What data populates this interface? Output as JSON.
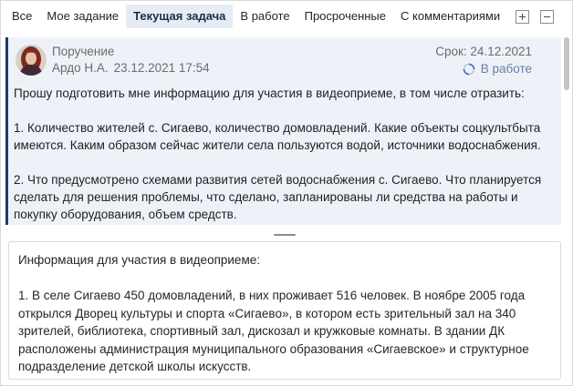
{
  "tabs": [
    {
      "label": "Все",
      "active": false
    },
    {
      "label": "Мое задание",
      "active": false
    },
    {
      "label": "Текущая задача",
      "active": true
    },
    {
      "label": "В работе",
      "active": false
    },
    {
      "label": "Просроченные",
      "active": false
    },
    {
      "label": "С комментариями",
      "active": false
    }
  ],
  "task": {
    "kind": "Поручение",
    "author": "Ардо Н.А.",
    "date": "23.12.2021 17:54",
    "deadline": "Срок: 24.12.2021",
    "status": "В работе",
    "paragraphs": [
      "Прошу подготовить мне информацию для участия в видеоприеме, в том числе отразить:",
      "1. Количество жителей с. Сигаево, количество домовладений. Какие объекты соцкультбыта имеются. Каким образом сейчас жители села пользуются водой, источники водоснабжения.",
      "2. Что предусмотрено схемами развития сетей водоснабжения с. Сигаево. Что планируется сделать для решения проблемы, что сделано, запланированы ли средства на работы и покупку оборудования, объем средств."
    ]
  },
  "reply": {
    "paragraphs": [
      "Информация для участия в видеоприеме:",
      "1. В селе Сигаево 450 домовладений, в них проживает 516 человек. В ноябре 2005 года открылся Дворец культуры и спорта «Сигаево», в котором есть зрительный зал на 340 зрителей, библиотека, спортивный зал, дискозал и кружковые комнаты. В здании ДК расположены администрация муниципального образования «Сигаевское» и структурное подразделение детской школы искусств."
    ]
  },
  "colors": {
    "accent": "#1f3a6b",
    "task_background": "#eef2f8",
    "active_tab_background": "#e6ecf6",
    "status_color": "#6b7f9f"
  },
  "icons": {
    "expand": "plus-box-icon",
    "collapse": "minus-box-icon",
    "status": "spinner-icon",
    "author": "avatar"
  }
}
